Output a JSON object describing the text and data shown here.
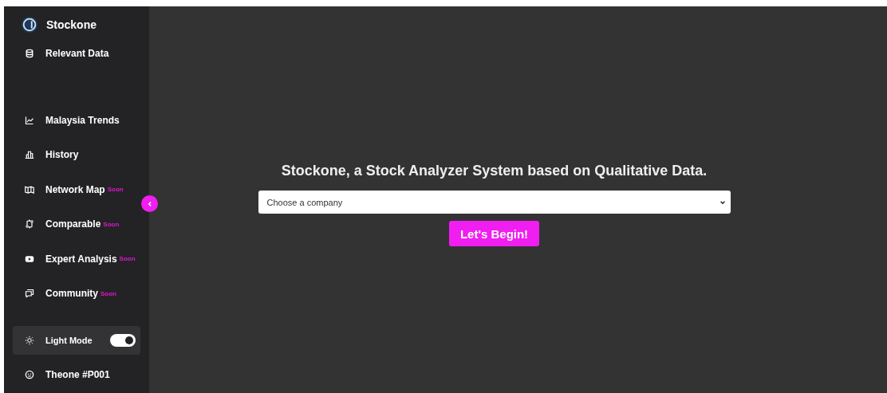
{
  "brand": {
    "name": "Stockone"
  },
  "nav_top": [
    {
      "label": "Relevant Data"
    }
  ],
  "nav": [
    {
      "label": "Malaysia Trends"
    },
    {
      "label": "History"
    },
    {
      "label": "Network Map",
      "badge": "Soon"
    },
    {
      "label": "Comparable",
      "badge": "Soon"
    },
    {
      "label": "Expert Analysis",
      "badge": "Soon"
    },
    {
      "label": "Community",
      "badge": "Soon"
    }
  ],
  "light_mode": {
    "label": "Light Mode",
    "on": true
  },
  "user": {
    "label": "Theone #P001"
  },
  "sidebar": {
    "expanded": true
  },
  "main": {
    "heading": "Stockone, a Stock Analyzer System based on Qualitative Data.",
    "company_select": {
      "placeholder": "Choose a company"
    },
    "button": "Let's Begin!"
  }
}
